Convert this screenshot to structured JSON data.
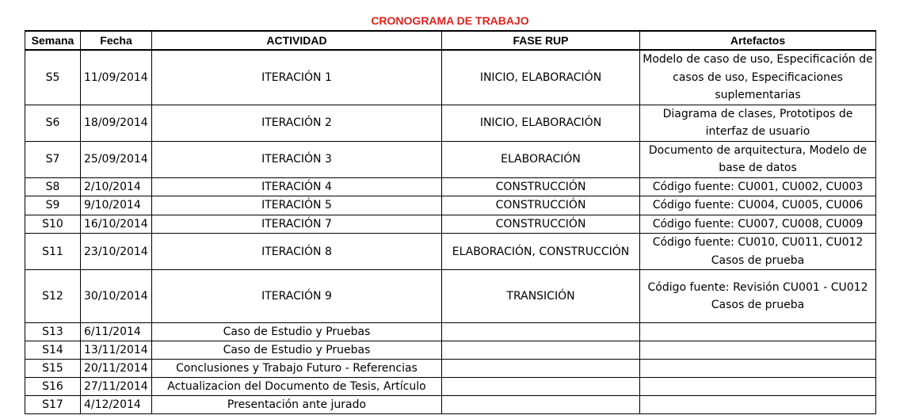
{
  "title": "CRONOGRAMA DE TRABAJO",
  "headers": {
    "semana": "Semana",
    "fecha": "Fecha",
    "actividad": "ACTIVIDAD",
    "fase": "FASE RUP",
    "artefactos": "Artefactos"
  },
  "rows": [
    {
      "semana": "S5",
      "fecha": "11/09/2014",
      "actividad": "ITERACIÓN 1",
      "fase": "INICIO, ELABORACIÓN",
      "artefactos": "Modelo de caso de uso, Especificación de casos de uso, Especificaciones suplementarias"
    },
    {
      "semana": "S6",
      "fecha": "18/09/2014",
      "actividad": "ITERACIÓN 2",
      "fase": "INICIO, ELABORACIÓN",
      "artefactos": "Diagrama de clases, Prototipos de interfaz de usuario"
    },
    {
      "semana": "S7",
      "fecha": "25/09/2014",
      "actividad": "ITERACIÓN 3",
      "fase": "ELABORACIÓN",
      "artefactos": "Documento de arquitectura, Modelo de base de datos"
    },
    {
      "semana": "S8",
      "fecha": "2/10/2014",
      "actividad": "ITERACIÓN 4",
      "fase": "CONSTRUCCIÓN",
      "artefactos": "Código fuente: CU001, CU002, CU003"
    },
    {
      "semana": "S9",
      "fecha": "9/10/2014",
      "actividad": "ITERACIÓN 5",
      "fase": "CONSTRUCCIÓN",
      "artefactos": "Código fuente: CU004, CU005, CU006"
    },
    {
      "semana": "S10",
      "fecha": "16/10/2014",
      "actividad": "ITERACIÓN 7",
      "fase": "CONSTRUCCIÓN",
      "artefactos": "Código fuente: CU007, CU008, CU009"
    },
    {
      "semana": "S11",
      "fecha": "23/10/2014",
      "actividad": "ITERACIÓN 8",
      "fase": "ELABORACIÓN, CONSTRUCCIÓN",
      "artefactos": "Código fuente: CU010, CU011, CU012 Casos de prueba"
    },
    {
      "semana": "S12",
      "fecha": "30/10/2014",
      "actividad": "ITERACIÓN 9",
      "fase": "TRANSICIÓN",
      "artefactos": "Código fuente: Revisión CU001 - CU012 Casos de prueba"
    },
    {
      "semana": "S13",
      "fecha": "6/11/2014",
      "actividad": "Caso de Estudio y Pruebas",
      "fase": "",
      "artefactos": ""
    },
    {
      "semana": "S14",
      "fecha": "13/11/2014",
      "actividad": "Caso de Estudio y Pruebas",
      "fase": "",
      "artefactos": ""
    },
    {
      "semana": "S15",
      "fecha": "20/11/2014",
      "actividad": "Conclusiones y Trabajo Futuro - Referencias",
      "fase": "",
      "artefactos": ""
    },
    {
      "semana": "S16",
      "fecha": "27/11/2014",
      "actividad": "Actualizacion del Documento de Tesis, Artículo",
      "fase": "",
      "artefactos": ""
    },
    {
      "semana": "S17",
      "fecha": "4/12/2014",
      "actividad": "Presentación ante jurado",
      "fase": "",
      "artefactos": ""
    }
  ]
}
